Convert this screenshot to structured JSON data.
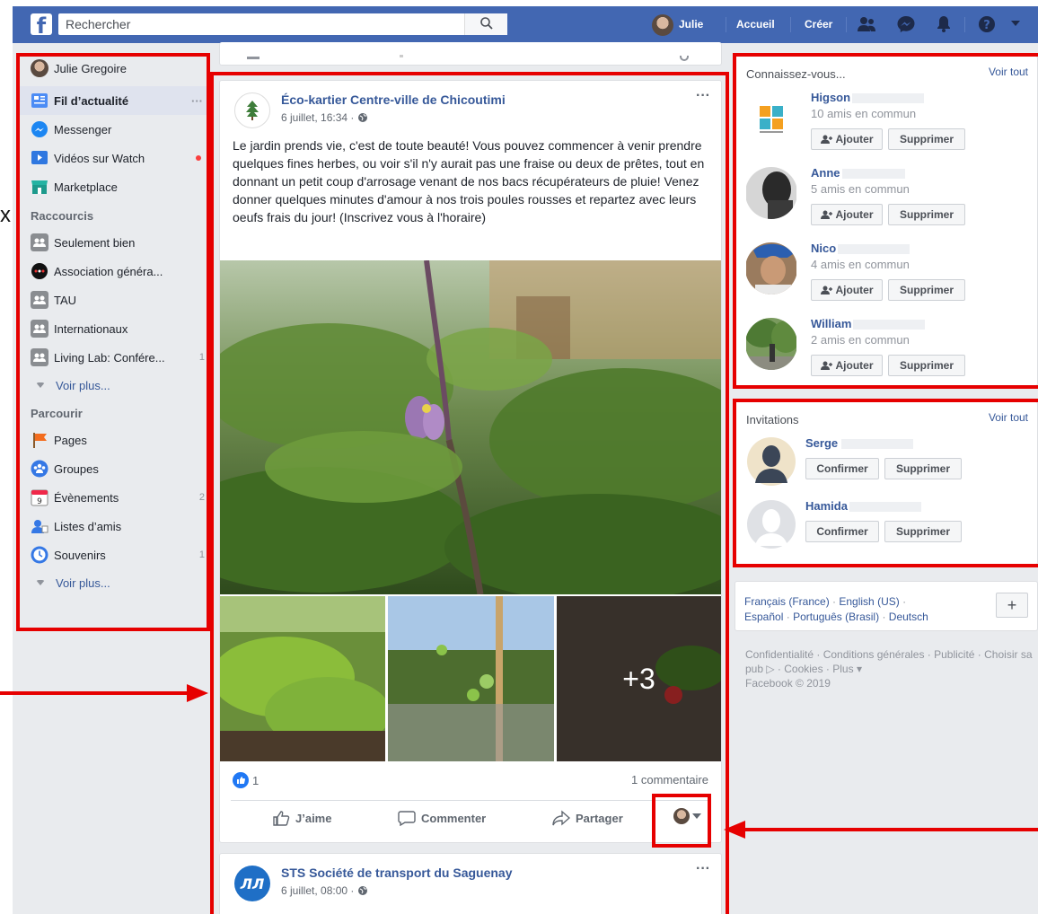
{
  "topbar": {
    "logo": "f",
    "search_placeholder": "Rechercher",
    "user": "Julie",
    "home": "Accueil",
    "create": "Créer"
  },
  "leftnav": {
    "profile": "Julie Gregoire",
    "feed": "Fil d’actualité",
    "feed_more": "···",
    "messenger": "Messenger",
    "watch": "Vidéos sur Watch",
    "marketplace": "Marketplace",
    "shortcuts_head": "Raccourcis",
    "shortcuts": [
      {
        "label": "Seulement bien",
        "count": ""
      },
      {
        "label": "Association généra...",
        "count": ""
      },
      {
        "label": "TAU",
        "count": ""
      },
      {
        "label": "Internationaux",
        "count": ""
      },
      {
        "label": "Living Lab: Confére...",
        "count": "1"
      }
    ],
    "see_more": "Voir plus...",
    "explore_head": "Parcourir",
    "explore": [
      {
        "label": "Pages",
        "count": ""
      },
      {
        "label": "Groupes",
        "count": ""
      },
      {
        "label": "Évènements",
        "count": "2"
      },
      {
        "label": "Listes d’amis",
        "count": ""
      },
      {
        "label": "Souvenirs",
        "count": "1"
      }
    ],
    "see_more2": "Voir plus..."
  },
  "post": {
    "page_name": "Éco-kartier Centre-ville de Chicoutimi",
    "date": "6 juillet, 16:34 ·",
    "menu": "···",
    "text": "Le jardin prends vie, c'est de toute beauté! Vous pouvez commencer à venir prendre quelques fines herbes, ou voir s'il n'y aurait pas une fraise ou deux de prêtes, tout en donnant un petit coup d'arrosage venant de nos bacs récupérateurs de pluie! Venez donner quelques minutes d'amour à nos trois poules rousses et repartez avec leurs oeufs frais du jour! (Inscrivez vous à l'horaire)",
    "more_photos": "+3",
    "likes": "1",
    "comments": "1 commentaire",
    "like": "J’aime",
    "comment": "Commenter",
    "share": "Partager"
  },
  "post2": {
    "page_name": "STS Société de transport du Saguenay",
    "date": "6 juillet, 08:00 ·",
    "menu": "···"
  },
  "people": {
    "title": "Connaissez-vous...",
    "see_all": "Voir tout",
    "add": "Ajouter",
    "remove": "Supprimer",
    "list": [
      {
        "name": "Higson",
        "mutual": "10 amis en commun"
      },
      {
        "name": "Anne",
        "mutual": "5 amis en commun"
      },
      {
        "name": "Nico",
        "mutual": "4 amis en commun"
      },
      {
        "name": "William",
        "mutual": "2 amis en commun"
      }
    ]
  },
  "invitations": {
    "title": "Invitations",
    "see_all": "Voir tout",
    "confirm": "Confirmer",
    "remove": "Supprimer",
    "list": [
      {
        "name": "Serge"
      },
      {
        "name": "Hamida"
      }
    ]
  },
  "languages": {
    "fr": "Français (France)",
    "sep": "·",
    "en": "English (US)",
    "es": "Español",
    "pt": "Português (Brasil)",
    "de": "Deutsch",
    "plus": "+"
  },
  "footer": {
    "line": "Confidentialité · Conditions générales · Publicité · Choisir sa pub ▷ · Cookies · Plus ▾",
    "copyright": "Facebook © 2019"
  },
  "overlay": {
    "cut_text": "x"
  },
  "colors": {
    "brand": "#4267b2",
    "link": "#365899",
    "annotation": "#e60000"
  }
}
